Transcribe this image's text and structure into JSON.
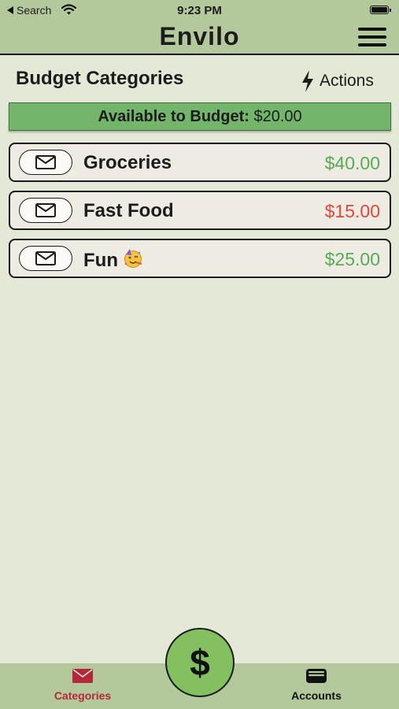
{
  "status_bar": {
    "back_label": "Search",
    "time": "9:23 PM"
  },
  "header": {
    "title": "Envilo"
  },
  "section": {
    "title": "Budget Categories",
    "actions_label": "Actions"
  },
  "available": {
    "label": "Available to Budget:",
    "amount": "$20.00"
  },
  "categories": [
    {
      "name": "Groceries",
      "amount": "$40.00",
      "amount_color": "#55ac55"
    },
    {
      "name": "Fast Food",
      "amount": "$15.00",
      "amount_color": "#e2473d"
    },
    {
      "name": "Fun",
      "emoji": "partying-face",
      "amount": "$25.00",
      "amount_color": "#55ac55"
    }
  ],
  "fab": {
    "label": "$"
  },
  "tabs": [
    {
      "label": "Categories",
      "icon": "envelope-icon",
      "active": true,
      "color": "#b5283b"
    },
    {
      "label": "Accounts",
      "icon": "wallet-icon",
      "active": false,
      "color": "#111111"
    }
  ],
  "colors": {
    "header_bg": "#b4c99b",
    "page_bg": "#e3e9d6",
    "available_bg": "#72b56b",
    "positive": "#55ac55",
    "negative": "#e2473d"
  }
}
